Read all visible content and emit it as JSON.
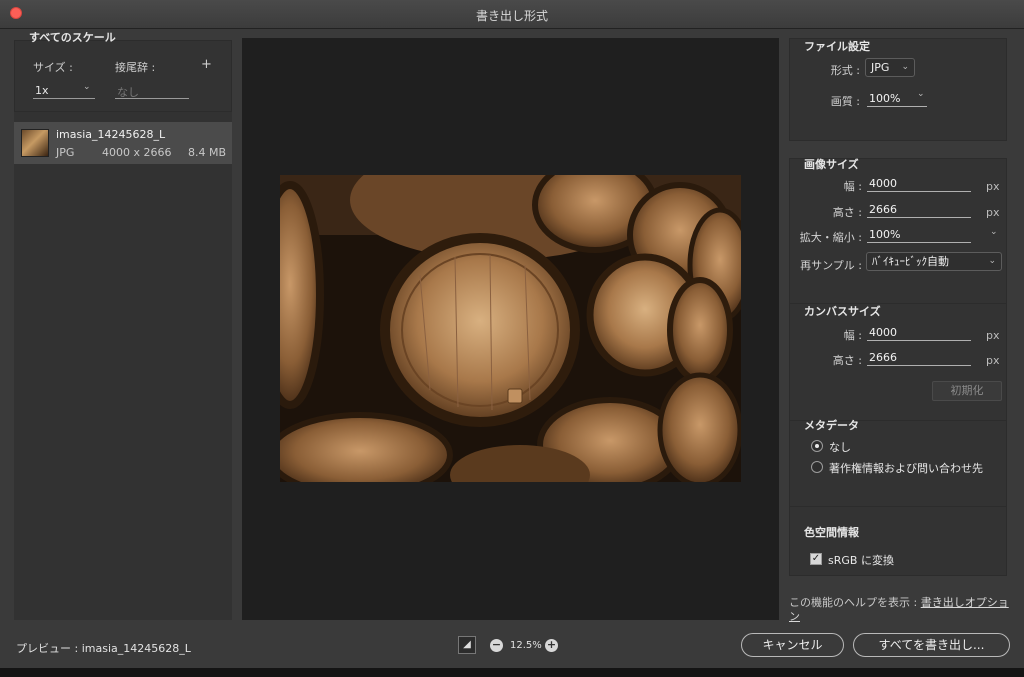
{
  "window": {
    "title": "書き出し形式"
  },
  "scale_panel": {
    "title": "すべてのスケール",
    "size_label": "サイズ :",
    "suffix_label": "接尾辞 :",
    "add_symbol": "+",
    "size_value": "1x",
    "suffix_placeholder": "なし"
  },
  "asset": {
    "name": "imasia_14245628_L",
    "format": "JPG",
    "dimensions": "4000 x 2666",
    "filesize": "8.4 MB"
  },
  "file_settings": {
    "title": "ファイル設定",
    "format_label": "形式 :",
    "format_value": "JPG",
    "quality_label": "画質 :",
    "quality_value": "100%"
  },
  "image_size": {
    "title": "画像サイズ",
    "width_label": "幅 :",
    "width_value": "4000",
    "height_label": "高さ :",
    "height_value": "2666",
    "scale_label": "拡大・縮小 :",
    "scale_value": "100%",
    "resample_label": "再サンプル :",
    "resample_value": "ﾊﾞｲｷｭｰﾋﾞｯｸ自動",
    "unit": "px"
  },
  "canvas_size": {
    "title": "カンバスサイズ",
    "width_label": "幅 :",
    "width_value": "4000",
    "height_label": "高さ :",
    "height_value": "2666",
    "unit": "px",
    "reset_label": "初期化"
  },
  "metadata": {
    "title": "メタデータ",
    "option_none": "なし",
    "option_copyright": "著作権情報および問い合わせ先",
    "selected": "なし"
  },
  "color_space": {
    "title": "色空間情報",
    "srgb_label": "sRGB に変換",
    "srgb_checked": true
  },
  "help": {
    "prefix": "この機能のヘルプを表示 : ",
    "link": "書き出しオプション"
  },
  "bottom": {
    "preview_label": "プレビュー : imasia_14245628_L",
    "zoom_value": "12.5%",
    "cancel_label": "キャンセル",
    "export_label": "すべてを書き出し..."
  }
}
